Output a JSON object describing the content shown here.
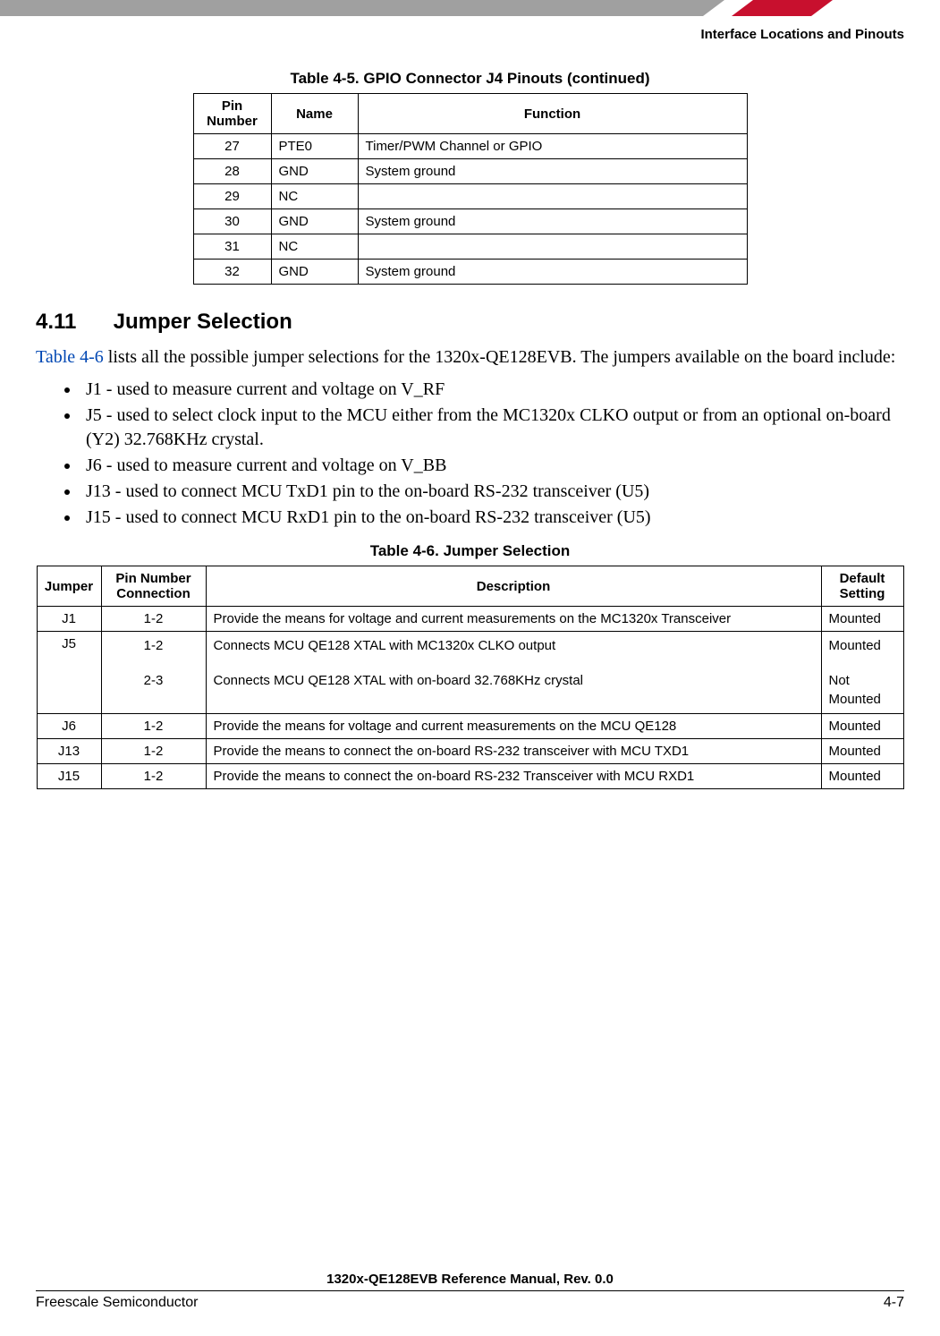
{
  "header": {
    "section_title": "Interface Locations and Pinouts"
  },
  "table45": {
    "caption": "Table 4-5. GPIO Connector J4 Pinouts (continued)",
    "headers": [
      "Pin Number",
      "Name",
      "Function"
    ],
    "rows": [
      {
        "pin": "27",
        "name": "PTE0",
        "func": "Timer/PWM Channel or GPIO"
      },
      {
        "pin": "28",
        "name": "GND",
        "func": "System ground"
      },
      {
        "pin": "29",
        "name": "NC",
        "func": ""
      },
      {
        "pin": "30",
        "name": "GND",
        "func": "System ground"
      },
      {
        "pin": "31",
        "name": "NC",
        "func": ""
      },
      {
        "pin": "32",
        "name": "GND",
        "func": "System ground"
      }
    ]
  },
  "section": {
    "number": "4.11",
    "title": "Jumper Selection",
    "intro_link": "Table 4-6",
    "intro_rest": " lists all the possible jumper selections for the 1320x-QE128EVB. The jumpers available on the board include:",
    "bullets": [
      "J1 - used to measure current and voltage on V_RF",
      "J5 - used to select clock input to the MCU either from the MC1320x CLKO output or from an optional on-board (Y2) 32.768KHz crystal.",
      "J6 - used to measure current and voltage on V_BB",
      "J13 - used to connect MCU TxD1 pin to the on-board RS-232 transceiver (U5)",
      "J15 - used to connect MCU RxD1 pin to the on-board RS-232 transceiver (U5)"
    ]
  },
  "table46": {
    "caption": "Table 4-6.  Jumper Selection",
    "headers": [
      "Jumper",
      "Pin Number Connection",
      "Description",
      "Default Setting"
    ],
    "rows": {
      "j1": {
        "jumper": "J1",
        "pin": "1-2",
        "desc": "Provide the means for voltage and current measurements on the MC1320x Transceiver",
        "def": "Mounted"
      },
      "j5": {
        "jumper": "J5",
        "pin1": "1-2",
        "pin2": "2-3",
        "desc1": "Connects MCU QE128 XTAL with MC1320x CLKO output",
        "desc2": "Connects MCU QE128 XTAL with on-board 32.768KHz crystal",
        "def1": "Mounted",
        "def2": "Not Mounted"
      },
      "j6": {
        "jumper": "J6",
        "pin": "1-2",
        "desc": "Provide the means for voltage and current measurements on the MCU QE128",
        "def": "Mounted"
      },
      "j13": {
        "jumper": "J13",
        "pin": "1-2",
        "desc": "Provide the means to connect the on-board RS-232 transceiver with MCU TXD1",
        "def": "Mounted"
      },
      "j15": {
        "jumper": "J15",
        "pin": "1-2",
        "desc": "Provide the means to connect the on-board RS-232 Transceiver with MCU RXD1",
        "def": "Mounted"
      }
    }
  },
  "footer": {
    "doc_title": "1320x-QE128EVB Reference Manual, Rev. 0.0",
    "company": "Freescale Semiconductor",
    "page": "4-7"
  }
}
